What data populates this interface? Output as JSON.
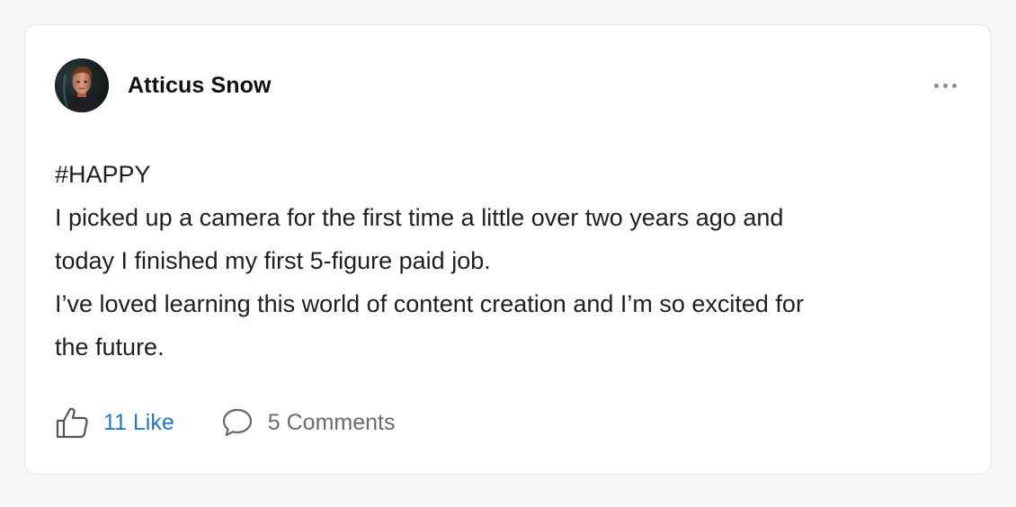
{
  "post": {
    "author_name": "Atticus Snow",
    "avatar_icon": "avatar-photo",
    "more_icon": "more-horizontal-icon",
    "body_lines": [
      "#HAPPY",
      "I picked up a camera for the first time a little over two years ago and",
      "today I finished my first 5-figure paid job.",
      "I’ve loved learning this world of content creation and I’m so excited for",
      "the future."
    ],
    "like_label": "11 Like",
    "comment_label": "5 Comments",
    "colors": {
      "accent": "#1f78d1",
      "muted": "#6b6b6b",
      "background": "#f7f7f7",
      "card": "#ffffff"
    }
  }
}
